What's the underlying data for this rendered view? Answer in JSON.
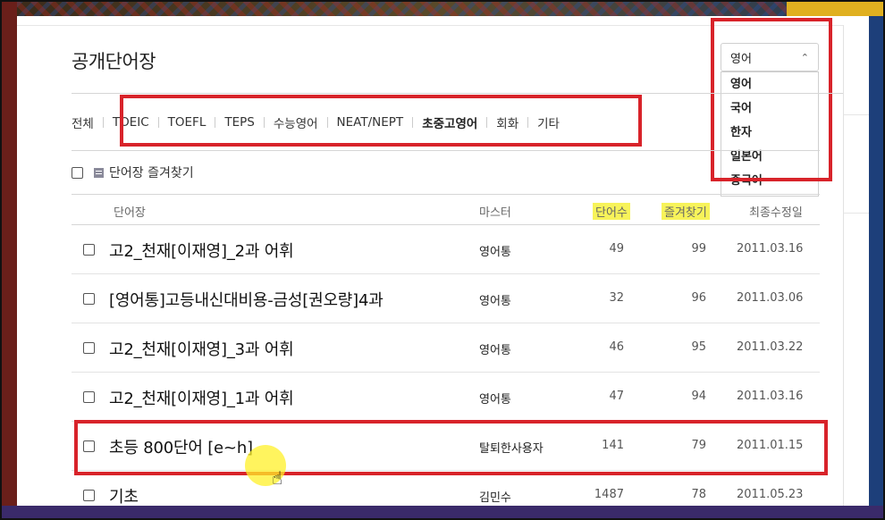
{
  "page_title": "공개단어장",
  "language_select": {
    "selected": "영어",
    "options": [
      "영어",
      "국어",
      "한자",
      "일본어",
      "중국어"
    ]
  },
  "categories": [
    "전체",
    "TOEIC",
    "TOEFL",
    "TEPS",
    "수능영어",
    "NEAT/NEPT",
    "초중고영어",
    "회화",
    "기타"
  ],
  "favorites_label": "단어장 즐겨찾기",
  "table": {
    "headers": {
      "name": "단어장",
      "master": "마스터",
      "word_count": "단어수",
      "favorites": "즐겨찾기",
      "modified": "최종수정일"
    },
    "rows": [
      {
        "name": "고2_천재[이재영]_2과 어휘",
        "master": "영어통",
        "words": "49",
        "favs": "99",
        "date": "2011.03.16"
      },
      {
        "name": "[영어통]고등내신대비용-금성[권오량]4과",
        "master": "영어통",
        "words": "32",
        "favs": "96",
        "date": "2011.03.06"
      },
      {
        "name": "고2_천재[이재영]_3과 어휘",
        "master": "영어통",
        "words": "46",
        "favs": "95",
        "date": "2011.03.22"
      },
      {
        "name": "고2_천재[이재영]_1과 어휘",
        "master": "영어통",
        "words": "47",
        "favs": "94",
        "date": "2011.03.16"
      },
      {
        "name": "초등 800단어 [e~h]",
        "master": "탈퇴한사용자",
        "words": "141",
        "favs": "79",
        "date": "2011.01.15"
      },
      {
        "name": "기초",
        "master": "김민수",
        "words": "1487",
        "favs": "78",
        "date": "2011.05.23"
      }
    ]
  },
  "highlight_color": "#d8232a",
  "marker_color": "#f7f35a",
  "icons": {
    "select_chevron": "chevron-up-icon",
    "favorites": "list-icon",
    "cursor": "hand-pointer-icon"
  }
}
